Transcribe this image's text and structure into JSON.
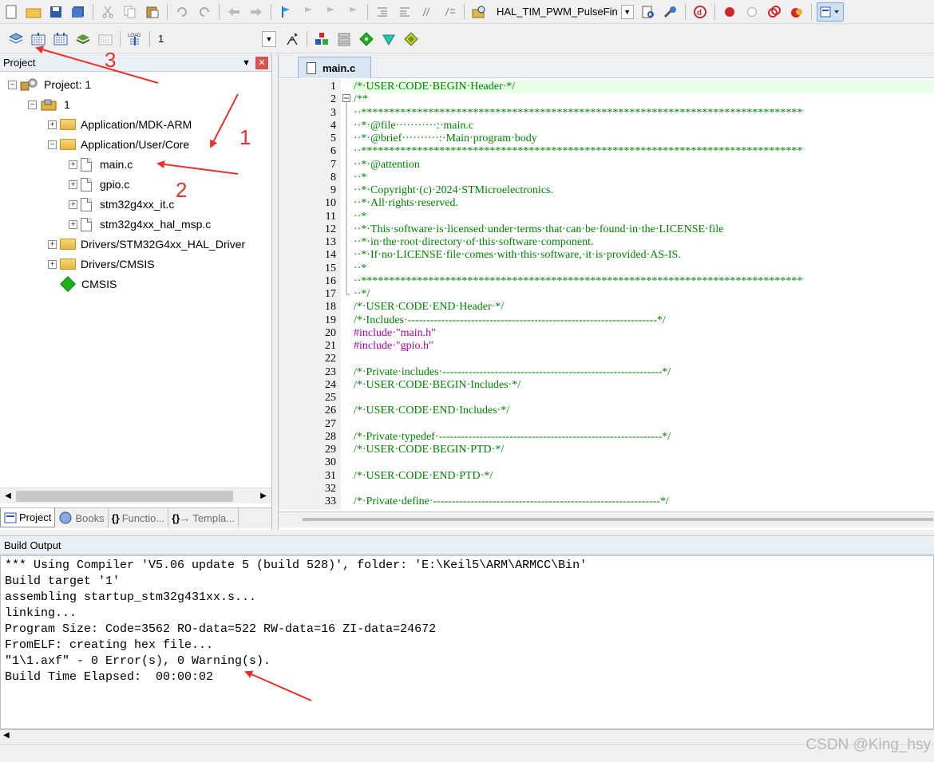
{
  "toolbar1": {
    "target_combo": "HAL_TIM_PWM_PulseFin"
  },
  "toolbar2": {
    "target_name": "1"
  },
  "project": {
    "title": "Project",
    "root": "Project: 1",
    "target": "1",
    "groups": [
      {
        "label": "Application/MDK-ARM"
      },
      {
        "label": "Application/User/Core"
      },
      {
        "label": "main.c"
      },
      {
        "label": "gpio.c"
      },
      {
        "label": "stm32g4xx_it.c"
      },
      {
        "label": "stm32g4xx_hal_msp.c"
      },
      {
        "label": "Drivers/STM32G4xx_HAL_Driver"
      },
      {
        "label": "Drivers/CMSIS"
      },
      {
        "label": "CMSIS"
      }
    ],
    "tabs": [
      "Project",
      "Books",
      "Functio...",
      "Templa..."
    ]
  },
  "editor": {
    "tab_label": "main.c",
    "lines": [
      {
        "n": "1",
        "text": "/*·USER·CODE·BEGIN·Header·*/"
      },
      {
        "n": "2",
        "text": "/**"
      },
      {
        "n": "3",
        "text": "··*******************************************************************************"
      },
      {
        "n": "4",
        "text": "··*·@file···········:·main.c"
      },
      {
        "n": "5",
        "text": "··*·@brief··········:·Main·program·body"
      },
      {
        "n": "6",
        "text": "··*******************************************************************************"
      },
      {
        "n": "7",
        "text": "··*·@attention"
      },
      {
        "n": "8",
        "text": "··*"
      },
      {
        "n": "9",
        "text": "··*·Copyright·(c)·2024·STMicroelectronics."
      },
      {
        "n": "10",
        "text": "··*·All·rights·reserved."
      },
      {
        "n": "11",
        "text": "··*"
      },
      {
        "n": "12",
        "text": "··*·This·software·is·licensed·under·terms·that·can·be·found·in·the·LICENSE·file"
      },
      {
        "n": "13",
        "text": "··*·in·the·root·directory·of·this·software·component."
      },
      {
        "n": "14",
        "text": "··*·If·no·LICENSE·file·comes·with·this·software,·it·is·provided·AS-IS."
      },
      {
        "n": "15",
        "text": "··*"
      },
      {
        "n": "16",
        "text": "··*******************************************************************************"
      },
      {
        "n": "17",
        "text": "··*/"
      },
      {
        "n": "18",
        "text": "/*·USER·CODE·END·Header·*/"
      },
      {
        "n": "19",
        "text": "/*·Includes·-------------------------------------------------------------------*/"
      },
      {
        "n": "20",
        "text": "#include·\"main.h\""
      },
      {
        "n": "21",
        "text": "#include·\"gpio.h\""
      },
      {
        "n": "22",
        "text": ""
      },
      {
        "n": "23",
        "text": "/*·Private·includes·-----------------------------------------------------------*/"
      },
      {
        "n": "24",
        "text": "/*·USER·CODE·BEGIN·Includes·*/"
      },
      {
        "n": "25",
        "text": ""
      },
      {
        "n": "26",
        "text": "/*·USER·CODE·END·Includes·*/"
      },
      {
        "n": "27",
        "text": ""
      },
      {
        "n": "28",
        "text": "/*·Private·typedef·------------------------------------------------------------*/"
      },
      {
        "n": "29",
        "text": "/*·USER·CODE·BEGIN·PTD·*/"
      },
      {
        "n": "30",
        "text": ""
      },
      {
        "n": "31",
        "text": "/*·USER·CODE·END·PTD·*/"
      },
      {
        "n": "32",
        "text": ""
      },
      {
        "n": "33",
        "text": "/*·Private·define·-------------------------------------------------------------*/"
      }
    ]
  },
  "build": {
    "title": "Build Output",
    "lines": [
      "*** Using Compiler 'V5.06 update 5 (build 528)', folder: 'E:\\Keil5\\ARM\\ARMCC\\Bin'",
      "Build target '1'",
      "assembling startup_stm32g431xx.s...",
      "linking...",
      "Program Size: Code=3562 RO-data=522 RW-data=16 ZI-data=24672",
      "FromELF: creating hex file...",
      "\"1\\1.axf\" - 0 Error(s), 0 Warning(s).",
      "Build Time Elapsed:  00:00:02"
    ]
  },
  "annotations": {
    "n1": "1",
    "n2": "2",
    "n3": "3"
  },
  "watermark": "CSDN @King_hsy"
}
